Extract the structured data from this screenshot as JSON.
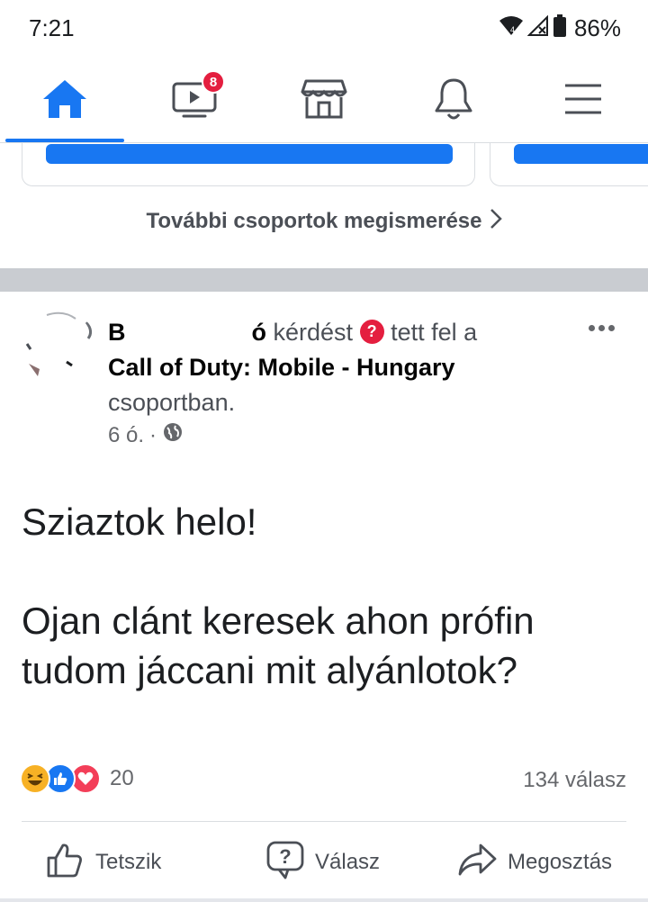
{
  "status_bar": {
    "time": "7:21",
    "network_label": "4",
    "battery": "86%"
  },
  "nav": {
    "items": [
      {
        "icon": "home-icon",
        "active": true
      },
      {
        "icon": "watch-video-icon",
        "badge": "8"
      },
      {
        "icon": "marketplace-icon"
      },
      {
        "icon": "notifications-bell-icon"
      },
      {
        "icon": "menu-icon"
      }
    ],
    "accent": "#1877f2",
    "badge_color": "#e41e3f"
  },
  "groups_section": {
    "see_more_label": "További csoportok megismerése"
  },
  "post": {
    "author_start": "B",
    "author_end": "ó",
    "action_text": "kérdést",
    "action_suffix": "tett fel a",
    "group_name": "Call of Duty: Mobile - Hungary",
    "group_suffix": "csoportban.",
    "time_ago": "6 ó.",
    "privacy_icon": "globe-icon",
    "body": [
      "Sziaztok helo!",
      "Ojan clánt keresek ahon prófin tudom jáccani mit alyánlotok?"
    ],
    "reaction_icons": [
      "haha-icon",
      "like-icon",
      "love-icon"
    ],
    "reaction_count": "20",
    "comment_count": "134 válasz"
  },
  "actions": {
    "like_label": "Tetszik",
    "answer_label": "Válasz",
    "share_label": "Megosztás"
  }
}
